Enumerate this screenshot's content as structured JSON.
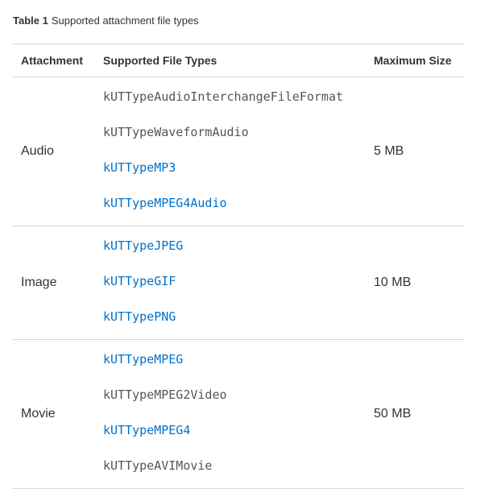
{
  "caption": {
    "label": "Table 1",
    "text": "Supported attachment file types"
  },
  "columns": {
    "attachment": "Attachment",
    "types": "Supported File Types",
    "size": "Maximum Size"
  },
  "link_color": "#0070c9",
  "text_color": "#555555",
  "rows": [
    {
      "attachment": "Audio",
      "max_size": "5 MB",
      "types": [
        {
          "name": "kUTTypeAudioInterchangeFileFormat",
          "link": false
        },
        {
          "name": "kUTTypeWaveformAudio",
          "link": false
        },
        {
          "name": "kUTTypeMP3",
          "link": true
        },
        {
          "name": "kUTTypeMPEG4Audio",
          "link": true
        }
      ]
    },
    {
      "attachment": "Image",
      "max_size": "10 MB",
      "types": [
        {
          "name": "kUTTypeJPEG",
          "link": true
        },
        {
          "name": "kUTTypeGIF",
          "link": true
        },
        {
          "name": "kUTTypePNG",
          "link": true
        }
      ]
    },
    {
      "attachment": "Movie",
      "max_size": "50 MB",
      "types": [
        {
          "name": "kUTTypeMPEG",
          "link": true
        },
        {
          "name": "kUTTypeMPEG2Video",
          "link": false
        },
        {
          "name": "kUTTypeMPEG4",
          "link": true
        },
        {
          "name": "kUTTypeAVIMovie",
          "link": false
        }
      ]
    }
  ]
}
